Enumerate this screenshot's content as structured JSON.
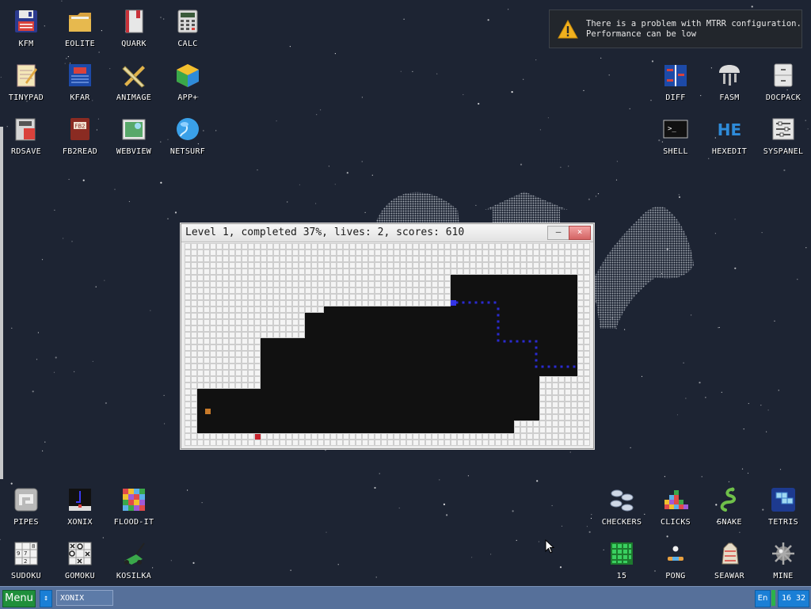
{
  "desktop": {
    "icons_top_left": [
      {
        "label": "KFM",
        "icon": "floppy-icon"
      },
      {
        "label": "EOLITE",
        "icon": "folder-icon"
      },
      {
        "label": "QUARK",
        "icon": "book-icon"
      },
      {
        "label": "CALC",
        "icon": "calculator-icon"
      },
      {
        "label": "TINYPAD",
        "icon": "notepad-icon"
      },
      {
        "label": "KFAR",
        "icon": "kfar-icon"
      },
      {
        "label": "ANIMAGE",
        "icon": "pencil-ruler-icon"
      },
      {
        "label": "APP+",
        "icon": "cube-icon"
      },
      {
        "label": "RDSAVE",
        "icon": "rdsave-icon"
      },
      {
        "label": "FB2READ",
        "icon": "fb2-book-icon"
      },
      {
        "label": "WEBVIEW",
        "icon": "webview-icon"
      },
      {
        "label": "NETSURF",
        "icon": "globe-icon"
      }
    ],
    "icons_top_right": [
      {
        "label": "DIFF",
        "icon": "diff-icon"
      },
      {
        "label": "FASM",
        "icon": "fasm-icon"
      },
      {
        "label": "DOCPACK",
        "icon": "cabinet-icon"
      },
      {
        "label": "SHELL",
        "icon": "terminal-icon"
      },
      {
        "label": "HEXEDIT",
        "icon": "hexedit-icon"
      },
      {
        "label": "SYSPANEL",
        "icon": "sliders-icon"
      }
    ],
    "icons_bottom_left": [
      {
        "label": "PIPES",
        "icon": "pipes-icon"
      },
      {
        "label": "XONIX",
        "icon": "xonix-icon"
      },
      {
        "label": "FLOOD-IT",
        "icon": "flood-it-icon"
      },
      {
        "label": "SUDOKU",
        "icon": "sudoku-icon"
      },
      {
        "label": "GOMOKU",
        "icon": "gomoku-icon"
      },
      {
        "label": "KOSILKA",
        "icon": "lawnmower-icon"
      }
    ],
    "icons_bottom_right": [
      {
        "label": "CHECKERS",
        "icon": "checkers-icon"
      },
      {
        "label": "CLICKS",
        "icon": "clicks-icon"
      },
      {
        "label": "SNAKE",
        "icon": "snake-icon"
      },
      {
        "label": "TETRIS",
        "icon": "tetris-icon"
      },
      {
        "label": "15",
        "icon": "fifteen-icon"
      },
      {
        "label": "PONG",
        "icon": "pong-icon"
      },
      {
        "label": "SEAWAR",
        "icon": "seawar-icon"
      },
      {
        "label": "MINE",
        "icon": "mine-icon"
      }
    ]
  },
  "notification": {
    "line1": "There is a problem with MTRR configuration.",
    "line2": "Performance can be low",
    "icon": "warning-icon"
  },
  "game_window": {
    "title": "Level 1, completed 37%, lives: 2, scores: 610",
    "minimize_label": "–",
    "close_label": "×"
  },
  "taskbar": {
    "menu_label": "Menu",
    "switch_label": "↕",
    "task_label": "XONIX",
    "lang": "En",
    "clock": "16 32"
  },
  "colors": {
    "desktop_bg": "#1d2433",
    "field_cell": "#dcdcdc",
    "field_filled": "#111111",
    "trail": "#2a2ad0",
    "taskbar": "#56709a",
    "menu_green": "#1f8f3b",
    "accent_blue": "#1a7fd6"
  }
}
